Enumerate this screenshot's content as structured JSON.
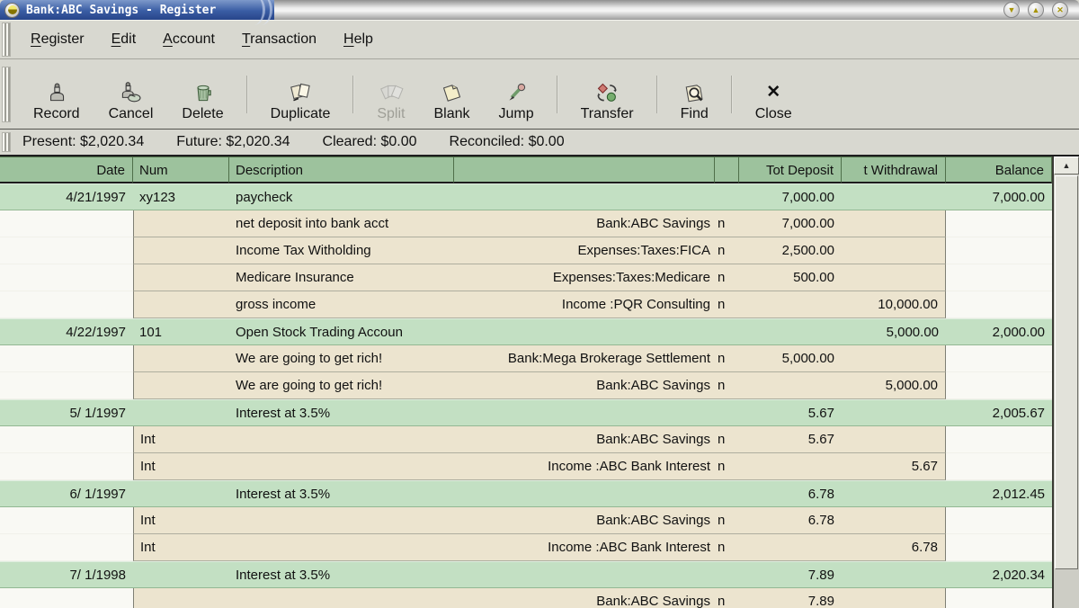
{
  "window": {
    "title": "Bank:ABC Savings - Register",
    "controls": [
      {
        "name": "minimize",
        "glyph": "▼"
      },
      {
        "name": "maximize",
        "glyph": "▲"
      },
      {
        "name": "close",
        "glyph": "✕"
      }
    ]
  },
  "menu_bar": {
    "items": [
      {
        "label": "Register"
      },
      {
        "label": "Edit"
      },
      {
        "label": "Account"
      },
      {
        "label": "Transaction"
      },
      {
        "label": "Help"
      }
    ]
  },
  "toolbar": {
    "buttons": [
      {
        "name": "record",
        "label": "Record",
        "disabled": false,
        "sep_after": false
      },
      {
        "name": "cancel",
        "label": "Cancel",
        "disabled": false,
        "sep_after": false
      },
      {
        "name": "delete",
        "label": "Delete",
        "disabled": false,
        "sep_after": true
      },
      {
        "name": "duplicate",
        "label": "Duplicate",
        "disabled": false,
        "sep_after": true
      },
      {
        "name": "split",
        "label": "Split",
        "disabled": true,
        "sep_after": false
      },
      {
        "name": "blank",
        "label": "Blank",
        "disabled": false,
        "sep_after": false
      },
      {
        "name": "jump",
        "label": "Jump",
        "disabled": false,
        "sep_after": true
      },
      {
        "name": "transfer",
        "label": "Transfer",
        "disabled": false,
        "sep_after": true
      },
      {
        "name": "find",
        "label": "Find",
        "disabled": false,
        "sep_after": true
      },
      {
        "name": "close",
        "label": "Close",
        "disabled": false,
        "sep_after": false
      }
    ]
  },
  "summary_bar": {
    "items": [
      {
        "name": "present",
        "label": "Present:",
        "value": "$2,020.34"
      },
      {
        "name": "future",
        "label": "Future:",
        "value": "$2,020.34"
      },
      {
        "name": "cleared",
        "label": "Cleared:",
        "value": "$0.00"
      },
      {
        "name": "reconciled",
        "label": "Reconciled:",
        "value": "$0.00"
      }
    ]
  },
  "register": {
    "columns": [
      {
        "key": "date",
        "label": "Date",
        "align": "right"
      },
      {
        "key": "num",
        "label": "Num",
        "align": "left"
      },
      {
        "key": "description",
        "label": "Description",
        "align": "left"
      },
      {
        "key": "transfer",
        "label": "",
        "align": "right"
      },
      {
        "key": "flag",
        "label": "",
        "align": "left"
      },
      {
        "key": "deposit",
        "label": "Tot Deposit",
        "align": "right"
      },
      {
        "key": "withdrawal",
        "label": "t Withdrawal",
        "align": "right"
      },
      {
        "key": "balance",
        "label": "Balance",
        "align": "right"
      }
    ],
    "rows": [
      {
        "type": "transaction",
        "date": "4/21/1997",
        "num": "xy123",
        "description": "paycheck",
        "transfer": "",
        "flag": "",
        "deposit": "7,000.00",
        "withdrawal": "",
        "balance": "7,000.00"
      },
      {
        "type": "split",
        "date": "",
        "num": "",
        "description": "net deposit into bank acct",
        "transfer": "Bank:ABC Savings",
        "flag": "n",
        "deposit": "7,000.00",
        "withdrawal": "",
        "balance": ""
      },
      {
        "type": "split",
        "date": "",
        "num": "",
        "description": "Income Tax Witholding",
        "transfer": "Expenses:Taxes:FICA",
        "flag": "n",
        "deposit": "2,500.00",
        "withdrawal": "",
        "balance": ""
      },
      {
        "type": "split",
        "date": "",
        "num": "",
        "description": "Medicare Insurance",
        "transfer": "Expenses:Taxes:Medicare",
        "flag": "n",
        "deposit": "500.00",
        "withdrawal": "",
        "balance": ""
      },
      {
        "type": "split",
        "date": "",
        "num": "",
        "description": "gross income",
        "transfer": "Income :PQR Consulting",
        "flag": "n",
        "deposit": "",
        "withdrawal": "10,000.00",
        "balance": ""
      },
      {
        "type": "transaction",
        "date": "4/22/1997",
        "num": "101",
        "description": "Open Stock Trading Accoun",
        "transfer": "",
        "flag": "",
        "deposit": "",
        "withdrawal": "5,000.00",
        "balance": "2,000.00"
      },
      {
        "type": "split",
        "date": "",
        "num": "",
        "description": "We are going to get rich!",
        "transfer": "Bank:Mega Brokerage Settlement",
        "flag": "n",
        "deposit": "5,000.00",
        "withdrawal": "",
        "balance": ""
      },
      {
        "type": "split",
        "date": "",
        "num": "",
        "description": "We are going to get rich!",
        "transfer": "Bank:ABC Savings",
        "flag": "n",
        "deposit": "",
        "withdrawal": "5,000.00",
        "balance": ""
      },
      {
        "type": "transaction",
        "date": "5/ 1/1997",
        "num": "",
        "description": "Interest at 3.5%",
        "transfer": "",
        "flag": "",
        "deposit": "5.67",
        "withdrawal": "",
        "balance": "2,005.67"
      },
      {
        "type": "split",
        "date": "",
        "num": "Int",
        "description": "",
        "transfer": "Bank:ABC Savings",
        "flag": "n",
        "deposit": "5.67",
        "withdrawal": "",
        "balance": ""
      },
      {
        "type": "split",
        "date": "",
        "num": "Int",
        "description": "",
        "transfer": "Income :ABC Bank Interest",
        "flag": "n",
        "deposit": "",
        "withdrawal": "5.67",
        "balance": ""
      },
      {
        "type": "transaction",
        "date": "6/ 1/1997",
        "num": "",
        "description": "Interest at 3.5%",
        "transfer": "",
        "flag": "",
        "deposit": "6.78",
        "withdrawal": "",
        "balance": "2,012.45"
      },
      {
        "type": "split",
        "date": "",
        "num": "Int",
        "description": "",
        "transfer": "Bank:ABC Savings",
        "flag": "n",
        "deposit": "6.78",
        "withdrawal": "",
        "balance": ""
      },
      {
        "type": "split",
        "date": "",
        "num": "Int",
        "description": "",
        "transfer": "Income :ABC Bank Interest",
        "flag": "n",
        "deposit": "",
        "withdrawal": "6.78",
        "balance": ""
      },
      {
        "type": "transaction",
        "date": "7/ 1/1998",
        "num": "",
        "description": "Interest at 3.5%",
        "transfer": "",
        "flag": "",
        "deposit": "7.89",
        "withdrawal": "",
        "balance": "2,020.34"
      },
      {
        "type": "split",
        "date": "",
        "num": "",
        "description": "",
        "transfer": "Bank:ABC Savings",
        "flag": "n",
        "deposit": "7.89",
        "withdrawal": "",
        "balance": ""
      }
    ]
  },
  "colors": {
    "titlebar_blue": "#3a5da4",
    "chrome_gray": "#d8d8d0",
    "header_green": "#9dc29d",
    "transaction_green": "#c3e0c3",
    "split_cream": "#ece4cf"
  }
}
